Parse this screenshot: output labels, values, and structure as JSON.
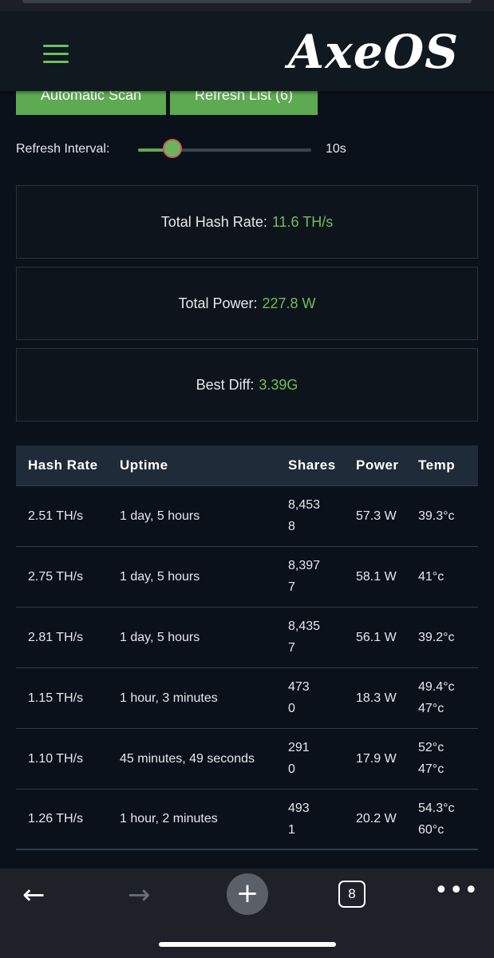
{
  "header": {
    "logo_text": "AxeOS",
    "menu_icon": "hamburger-menu-icon"
  },
  "actions": {
    "scan_label": "Automatic Scan",
    "refresh_label": "Refresh List (6)"
  },
  "refresh": {
    "label": "Refresh Interval:",
    "value": "10s",
    "level_fraction": 0.2
  },
  "stats": {
    "hash_label": "Total Hash Rate:",
    "hash_value": "11.6 TH/s",
    "power_label": "Total Power:",
    "power_value": "227.8 W",
    "diff_label": "Best Diff:",
    "diff_value": "3.39G"
  },
  "table": {
    "headers": [
      "Hash Rate",
      "Uptime",
      "Shares",
      "Power",
      "Temp"
    ],
    "rows": [
      {
        "hash": "2.51 TH/s",
        "uptime": "1 day, 5 hours",
        "shares1": "8,453",
        "shares2": "8",
        "power": "57.3 W",
        "temp1": "39.3°c",
        "temp2": ""
      },
      {
        "hash": "2.75 TH/s",
        "uptime": "1 day, 5 hours",
        "shares1": "8,397",
        "shares2": "7",
        "power": "58.1 W",
        "temp1": "41°c",
        "temp2": ""
      },
      {
        "hash": "2.81 TH/s",
        "uptime": "1 day, 5 hours",
        "shares1": "8,435",
        "shares2": "7",
        "power": "56.1 W",
        "temp1": "39.2°c",
        "temp2": ""
      },
      {
        "hash": "1.15 TH/s",
        "uptime": "1 hour, 3 minutes",
        "shares1": "473",
        "shares2": "0",
        "power": "18.3 W",
        "temp1": "49.4°c",
        "temp2": "47°c"
      },
      {
        "hash": "1.10 TH/s",
        "uptime": "45 minutes, 49 seconds",
        "shares1": "291",
        "shares2": "0",
        "power": "17.9 W",
        "temp1": "52°c",
        "temp2": "47°c"
      },
      {
        "hash": "1.26 TH/s",
        "uptime": "1 hour, 2 minutes",
        "shares1": "493",
        "shares2": "1",
        "power": "20.2 W",
        "temp1": "54.3°c",
        "temp2": "60°c"
      }
    ]
  },
  "browser": {
    "back_icon": "arrow-left-icon",
    "forward_icon": "arrow-right-icon",
    "new_tab_icon": "plus-icon",
    "tab_count": "8",
    "more_icon": "more-dots-icon"
  },
  "colors": {
    "accent": "#5eaa52",
    "value_green": "#6fbf5a",
    "background": "#0b111a"
  }
}
